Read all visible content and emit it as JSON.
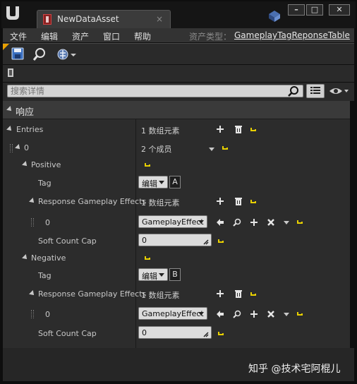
{
  "window": {
    "tab_title": "NewDataAsset",
    "tab_close": "×",
    "minimize_label": "–",
    "maximize_label": "□",
    "close_label": "✕"
  },
  "menu": {
    "items": [
      "文件",
      "编辑",
      "资产",
      "窗口",
      "帮助"
    ],
    "asset_type_label": "资产类型：",
    "asset_type_value": "GameplayTagReponseTable"
  },
  "toolbar": {
    "icons": [
      "save-icon",
      "find-in-browser-icon",
      "hierarchy-icon"
    ]
  },
  "details": {
    "search_placeholder": "搜索详情"
  },
  "panel": {
    "category": "响应",
    "entries_label": "Entries",
    "entries_value": "1 数组元素",
    "entry0_label": "0",
    "entry0_value": "2 个成员",
    "positive": {
      "label": "Positive",
      "tag_label": "Tag",
      "tag_edit": "编辑",
      "tag_value": "A",
      "effects_label": "Response Gameplay Effects",
      "effects_value": "1 数组元素",
      "effect0_label": "0",
      "effect0_value": "GameplayEffect",
      "cap_label": "Soft Count Cap",
      "cap_value": "0"
    },
    "negative": {
      "label": "Negative",
      "tag_label": "Tag",
      "tag_edit": "编辑",
      "tag_value": "B",
      "effects_label": "Response Gameplay Effects",
      "effects_value": "1 数组元素",
      "effect0_label": "0",
      "effect0_value": "GameplayEffect",
      "cap_label": "Soft Count Cap",
      "cap_value": "0"
    }
  },
  "watermark": "知乎 @技术宅阿棍儿",
  "colors": {
    "reset_yellow": "#e8d000",
    "toolbar_accent": "#e8a000"
  }
}
